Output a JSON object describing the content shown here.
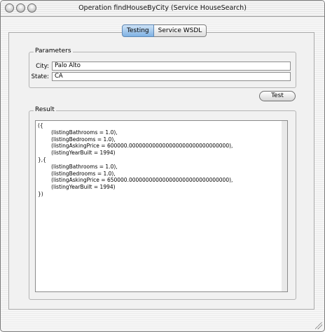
{
  "window": {
    "title": "Operation findHouseByCity (Service HouseSearch)"
  },
  "tabs": [
    {
      "label": "Testing",
      "selected": true
    },
    {
      "label": "Service WSDL",
      "selected": false
    }
  ],
  "parameters": {
    "group_label": "Parameters",
    "city": {
      "label": "City:",
      "value": "Palo Alto"
    },
    "state": {
      "label": "State:",
      "value": "CA"
    }
  },
  "test_button": {
    "label": "Test"
  },
  "result": {
    "group_label": "Result",
    "text": "({\n        (listingBathrooms = 1.0),\n        (listingBedrooms = 1.0),\n        (listingAskingPrice = 600000.000000000000000000000000000000),\n        (listingYearBuilt = 1994)\n},{\n        (listingBathrooms = 1.0),\n        (listingBedrooms = 1.0),\n        (listingAskingPrice = 650000.000000000000000000000000000000),\n        (listingYearBuilt = 1994)\n})"
  }
}
